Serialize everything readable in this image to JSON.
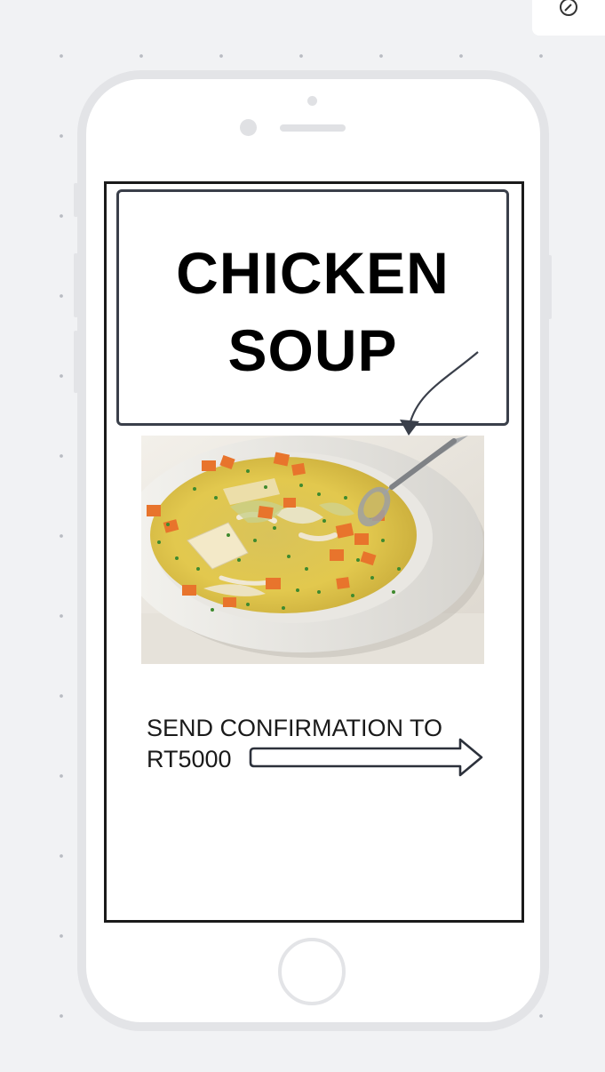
{
  "canvas": {
    "background_color": "#f1f2f4",
    "grid_dot_color": "#b9bcc2"
  },
  "toolbar": {
    "corner_icon": "magnifier-icon"
  },
  "phone": {
    "frame_color": "#e3e4e7",
    "screen_border_color": "#1a1a1a"
  },
  "card": {
    "title_line_1": "CHICKEN",
    "title_line_2": "SOUP",
    "title_border_color": "#3a3f4a"
  },
  "image": {
    "subject": "bowl of chicken soup with vegetables and a spoon"
  },
  "confirmation": {
    "line_1": "SEND CONFIRMATION TO",
    "line_2": "RT5000",
    "arrow_icon": "right-arrow-icon"
  },
  "connector": {
    "icon": "curved-arrow-icon",
    "color": "#3a3f4a"
  }
}
